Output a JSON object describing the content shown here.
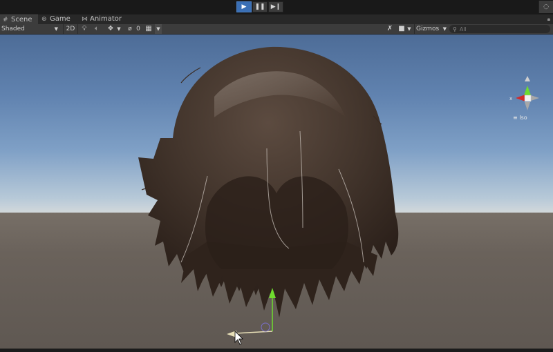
{
  "playbar": {
    "play_icon": "play-icon",
    "pause_icon": "pause-icon",
    "step_icon": "step-icon"
  },
  "tabs": [
    {
      "label": "Scene",
      "icon": "grid-icon"
    },
    {
      "label": "Game",
      "icon": "gamepad-icon"
    },
    {
      "label": "Animator",
      "icon": "animator-icon"
    }
  ],
  "toolbar": {
    "shading_mode": "Shaded",
    "mode_2d": "2D",
    "hidden_count": "0",
    "gizmos_label": "Gizmos",
    "search_placeholder": "All"
  },
  "scene_gizmo": {
    "projection_label": "Iso",
    "x_axis_label": "x"
  },
  "colors": {
    "accent_play": "#3a6fb5",
    "sky_top": "#4d6c97",
    "horizon": "#d2d8db",
    "ground": "#6a625b",
    "hair_dark": "#33261e",
    "hair_mid": "#4a3a30",
    "axis_x": "#d22a2a",
    "axis_y": "#6fdc2e"
  }
}
